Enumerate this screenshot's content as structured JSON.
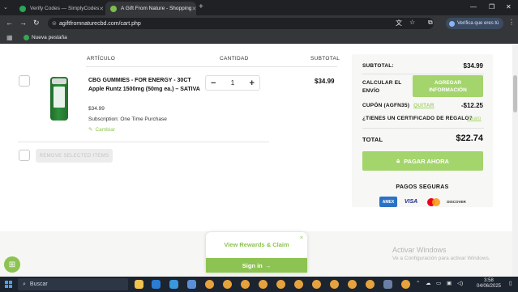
{
  "browser": {
    "tabs": [
      {
        "title": "Verify Codes — SimplyCodes",
        "active": false,
        "favicon_color": "#2aa55a"
      },
      {
        "title": "A Gift From Nature - Shopping",
        "active": true,
        "favicon_color": "#7bbf4b"
      }
    ],
    "url": "agiftfromnaturecbd.com/cart.php",
    "profile_label": "Verifica que eres tú",
    "bookmark": "Nueva pestaña"
  },
  "cart": {
    "headers": {
      "product": "ARTÍCULO",
      "quantity": "CANTIDAD",
      "subtotal": "SUBTOTAL"
    },
    "item": {
      "title": "CBG GUMMIES - FOR ENERGY - 30CT Apple Runtz 1500mg (50mg ea.) – SATIVA",
      "unit_price": "$34.99",
      "subscription": "Subscription: One Time Purchase",
      "change_label": "Cambiar",
      "quantity": "1",
      "line_total": "$34.99",
      "minus": "−",
      "plus": "+"
    },
    "remove_selected": "REMOVE SELECTED ITEMS"
  },
  "summary": {
    "subtotal_label": "SUBTOTAL:",
    "subtotal_value": "$34.99",
    "shipping_label": "CALCULAR EL ENVÍO",
    "add_info_button": "AGREGAR INFORMACIÓN",
    "coupon_label": "CUPÓN (AGFN35)",
    "coupon_remove": "QUITAR",
    "coupon_value": "-$12.25",
    "gift_cert_label": "¿TIENES UN CERTIFICADO DE REGALO?",
    "gift_cert_link": "Úsalo",
    "total_label": "TOTAL",
    "total_value": "$22.74",
    "pay_button": "PAGAR AHORA",
    "payments_title": "PAGOS SEGURAS",
    "cards": [
      "AMEX",
      "VISA",
      "MASTERCARD",
      "DISCOVER"
    ]
  },
  "rewards": {
    "link": "View Rewards & Claim",
    "close": "×",
    "signin": "Sign in"
  },
  "windows_watermark": {
    "title": "Activar Windows",
    "subtitle": "Ve a Configuración para activar Windows."
  },
  "taskbar": {
    "search_placeholder": "Buscar",
    "time": "3:58",
    "date": "04/06/2025"
  },
  "colors": {
    "accent_green": "#a4d46c",
    "rewards_green": "#8dc352",
    "chrome_dark": "#202124"
  }
}
